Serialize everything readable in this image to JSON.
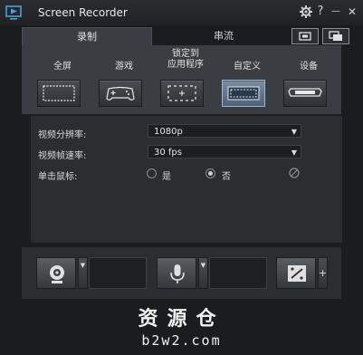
{
  "titlebar": {
    "title": "Screen Recorder",
    "settings_icon": "gear-icon",
    "help_label": "?",
    "minimize_label": "—",
    "close_label": "✕"
  },
  "tabs": {
    "record": "录制",
    "stream": "串流"
  },
  "modes": [
    {
      "label": "全屏",
      "icon": "fullscreen-icon",
      "selected": false
    },
    {
      "label": "游戏",
      "icon": "gamepad-icon",
      "selected": false
    },
    {
      "label": "锁定到\n应用程序",
      "icon": "lock-to-app-icon",
      "selected": false
    },
    {
      "label": "自定义",
      "icon": "custom-region-icon",
      "selected": true
    },
    {
      "label": "设备",
      "icon": "device-icon",
      "selected": false
    }
  ],
  "settings": {
    "resolution_label": "视频分辨率:",
    "resolution_value": "1080p",
    "fps_label": "视频帧速率:",
    "fps_value": "30 fps",
    "click_label": "单击鼠标:",
    "yes_label": "是",
    "no_label": "否",
    "selected": "否"
  },
  "watermark": {
    "cn": "资源仓",
    "url": "b2w2.com"
  },
  "colors": {
    "background": "#1a1c1e",
    "panel": "#3a3e42",
    "selected_mode": "#6a7f98"
  }
}
